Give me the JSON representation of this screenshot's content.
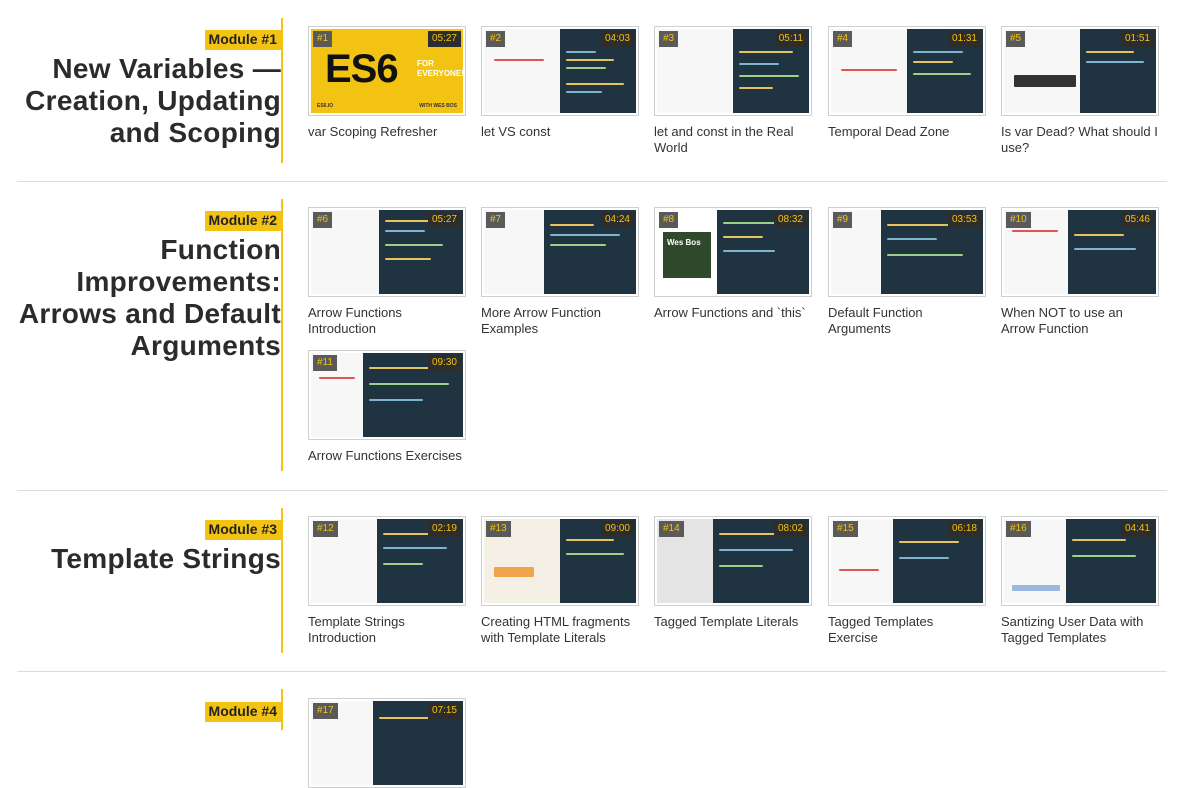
{
  "modules": [
    {
      "badge": "Module #1",
      "title_lines": [
        "New Variables —",
        "Creation, Updating",
        "and Scoping"
      ],
      "videos": [
        {
          "num": "#1",
          "duration": "05:27",
          "title": "var Scoping Refresher",
          "cover": {
            "big": "ES6",
            "small1": "FOR",
            "small2": "EVERYONE!",
            "foot_left": "ES6.IO",
            "foot_right": "WITH WES BOS"
          }
        },
        {
          "num": "#2",
          "duration": "04:03",
          "title": "let VS const"
        },
        {
          "num": "#3",
          "duration": "05:11",
          "title": "let and const in the Real World"
        },
        {
          "num": "#4",
          "duration": "01:31",
          "title": "Temporal Dead Zone"
        },
        {
          "num": "#5",
          "duration": "01:51",
          "title": "Is var Dead? What should I use?"
        }
      ]
    },
    {
      "badge": "Module #2",
      "title_lines": [
        "Function",
        "Improvements:",
        "Arrows and Default",
        "Arguments"
      ],
      "videos": [
        {
          "num": "#6",
          "duration": "05:27",
          "title": "Arrow Functions Introduction"
        },
        {
          "num": "#7",
          "duration": "04:24",
          "title": "More Arrow Function Examples"
        },
        {
          "num": "#8",
          "duration": "08:32",
          "title": "Arrow Functions and `this`",
          "photo_label": "Wes Bos"
        },
        {
          "num": "#9",
          "duration": "03:53",
          "title": "Default Function Arguments"
        },
        {
          "num": "#10",
          "duration": "05:46",
          "title": "When NOT to use an Arrow Function"
        },
        {
          "num": "#11",
          "duration": "09:30",
          "title": "Arrow Functions Exercises"
        }
      ]
    },
    {
      "badge": "Module #3",
      "title_lines": [
        "Template Strings"
      ],
      "videos": [
        {
          "num": "#12",
          "duration": "02:19",
          "title": "Template Strings Introduction"
        },
        {
          "num": "#13",
          "duration": "09:00",
          "title": "Creating HTML fragments with Template Literals"
        },
        {
          "num": "#14",
          "duration": "08:02",
          "title": "Tagged Template Literals"
        },
        {
          "num": "#15",
          "duration": "06:18",
          "title": "Tagged Templates Exercise"
        },
        {
          "num": "#16",
          "duration": "04:41",
          "title": "Santizing User Data with Tagged Templates"
        }
      ]
    },
    {
      "badge": "Module #4",
      "title_lines": [],
      "videos": [
        {
          "num": "#17",
          "duration": "07:15",
          "title": ""
        }
      ]
    }
  ],
  "colors": {
    "accent": "#f2c312",
    "editor_bg": "#1f3440",
    "badge_bg": "#5a5a5a"
  }
}
